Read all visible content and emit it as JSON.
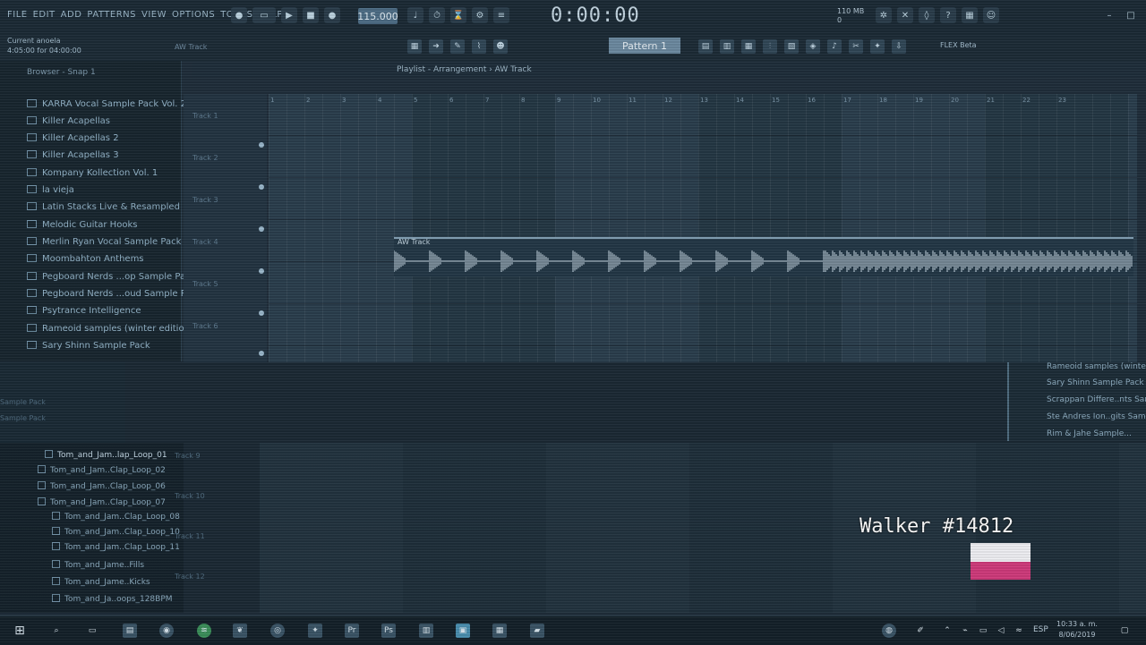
{
  "menu": [
    "FILE",
    "EDIT",
    "ADD",
    "PATTERNS",
    "VIEW",
    "OPTIONS",
    "TOOLS",
    "HELP"
  ],
  "tempo": "115.000",
  "time": "0:00:00",
  "hint": {
    "line1": "Current anoela",
    "line2": "4:05:00 for 04:00:00"
  },
  "pattern_label": "Pattern 1",
  "aw_track_label": "AW Track",
  "flex_label": "FLEX Beta",
  "cpu": {
    "mem": "110 MB",
    "voices": "0"
  },
  "browser": {
    "header": "Browser - Snap 1",
    "items": [
      "KARRA Vocal Sample Pack Vol. 2",
      "Killer Acapellas",
      "Killer Acapellas 2",
      "Killer Acapellas 3",
      "Kompany Kollection Vol. 1",
      "la vieja",
      "Latin Stacks Live & Resampled",
      "Melodic Guitar Hooks",
      "Merlin Ryan Vocal Sample Pack",
      "Moombahton Anthems",
      "Pegboard Nerds ...op Sample Pack",
      "Pegboard Nerds ...oud Sample Pack",
      "Psytrance Intelligence",
      "Rameoid samples (winter edition)",
      "Sary Shinn Sample Pack"
    ]
  },
  "playlist": {
    "title": "Playlist - Arrangement › AW Track",
    "ruler": [
      "1",
      "2",
      "3",
      "4",
      "5",
      "6",
      "7",
      "8",
      "9",
      "10",
      "11",
      "12",
      "13",
      "14",
      "15",
      "16",
      "17",
      "18",
      "19",
      "20",
      "21",
      "22",
      "23"
    ],
    "tracks": [
      "Track 1",
      "Track 2",
      "Track 3",
      "Track 4",
      "Track 5",
      "Track 6"
    ],
    "clip_label": "AW Track"
  },
  "lower_left": [
    "Tom_and_Jam..lap_Loop_01",
    "Tom_and_Jam..Clap_Loop_02",
    "Tom_and_Jam..Clap_Loop_06",
    "Tom_and_Jam..Clap_Loop_07",
    "Tom_and_Jam..Clap_Loop_08",
    "Tom_and_Jam..Clap_Loop_10",
    "Tom_and_Jam..Clap_Loop_11",
    "Tom_and_Jame..Fills",
    "Tom_and_Jame..Kicks",
    "Tom_and_Ja..oops_128BPM"
  ],
  "lower_tracks": [
    "Track 9",
    "Track 10",
    "Track 11",
    "Track 12"
  ],
  "right_panel": [
    "Rameoid samples (winter...",
    "Sary Shinn Sample Pack",
    "Scrappan Differe..nts Sam...",
    "Ste Andres Ion..gits Sam...",
    "Rim & Jahe Sample..."
  ],
  "overlay": {
    "text": "Walker #14812",
    "flag_top": "#f0f0f4",
    "flag_bottom": "#d03a7c"
  },
  "taskbar": {
    "clock_time": "10:33 a. m.",
    "clock_date": "8/06/2019",
    "lang": "ESP"
  }
}
